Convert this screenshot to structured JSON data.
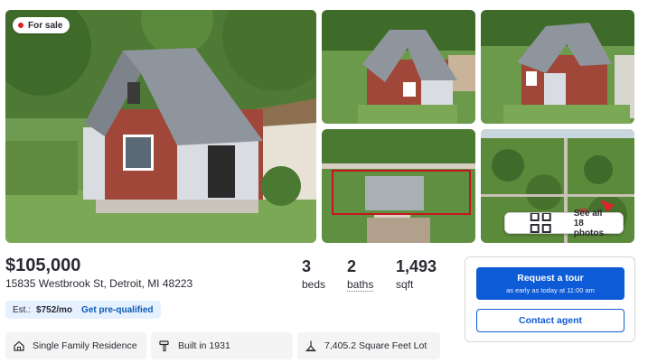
{
  "listing": {
    "status_badge": "For sale",
    "see_all_label": "See all 18 photos",
    "price": "$105,000",
    "address": "15835 Westbrook St, Detroit, MI 48223",
    "stats": [
      {
        "value": "3",
        "label": "beds"
      },
      {
        "value": "2",
        "label": "baths"
      },
      {
        "value": "1,493",
        "label": "sqft"
      }
    ],
    "estimate": {
      "label": "Est.:",
      "amount": "$752/mo",
      "link": "Get pre-qualified"
    },
    "facts": [
      {
        "icon": "house-icon",
        "text": "Single Family Residence"
      },
      {
        "icon": "hammer-icon",
        "text": "Built in 1931"
      },
      {
        "icon": "lot-size-icon",
        "text": "7,405.2 Square Feet Lot"
      }
    ]
  },
  "contact_card": {
    "tour_button": "Request a tour",
    "tour_subtext": "as early as today at 11:00 am",
    "agent_button": "Contact agent"
  },
  "colors": {
    "accent": "#0d5bd7",
    "badge_dot": "#d92228",
    "estimate_bg": "#e6f1ff"
  }
}
